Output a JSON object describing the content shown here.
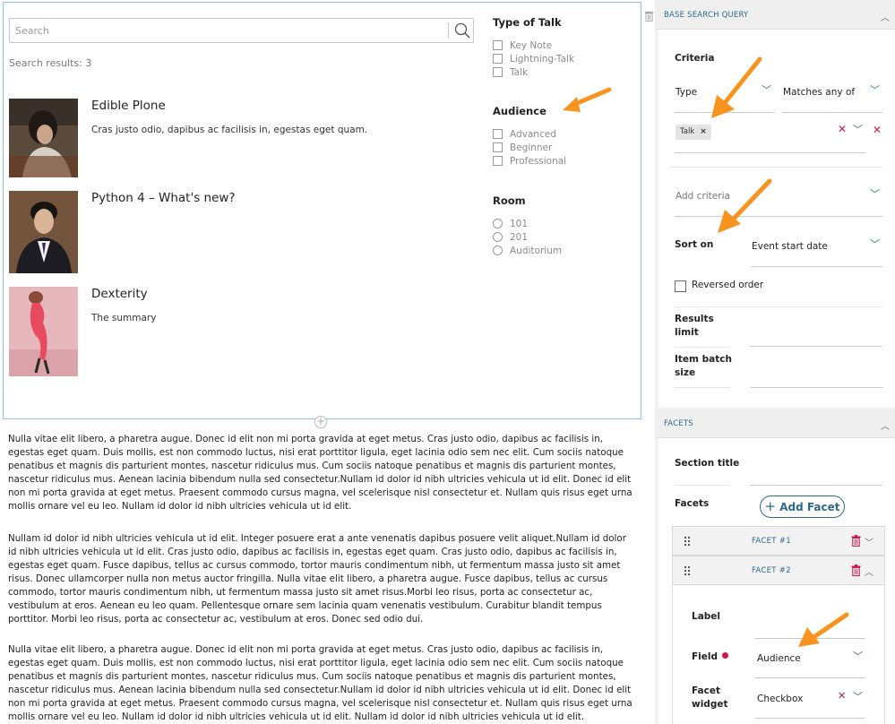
{
  "search": {
    "placeholder": "Search",
    "results_count": "Search results: 3"
  },
  "results": [
    {
      "title": "Edible Plone",
      "description": "Cras justo odio, dapibus ac facilisis in, egestas eget quam."
    },
    {
      "title": "Python 4 – What's new?",
      "description": ""
    },
    {
      "title": "Dexterity",
      "description": "The summary"
    }
  ],
  "facets_panel": [
    {
      "title": "Type of Talk",
      "options": [
        "Key Note",
        "Lightning-Talk",
        "Talk"
      ]
    },
    {
      "title": "Audience",
      "options": [
        "Advanced",
        "Beginner",
        "Professional"
      ]
    },
    {
      "title": "Room",
      "options": [
        "101",
        "201",
        "Auditorium"
      ]
    }
  ],
  "paragraphs": [
    "Nulla vitae elit libero, a pharetra augue. Donec id elit non mi porta gravida at eget metus. Cras justo odio, dapibus ac facilisis in, egestas eget quam. Duis mollis, est non commodo luctus, nisi erat porttitor ligula, eget lacinia odio sem nec elit. Cum sociis natoque penatibus et magnis dis parturient montes, nascetur ridiculus mus. Cum sociis natoque penatibus et magnis dis parturient montes, nascetur ridiculus mus. Aenean lacinia bibendum nulla sed consectetur.Nullam id dolor id nibh ultricies vehicula ut id elit. Donec id elit non mi porta gravida at eget metus. Praesent commodo cursus magna, vel scelerisque nisl consectetur et. Nullam quis risus eget urna mollis ornare vel eu leo. Nullam id dolor id nibh ultricies vehicula ut id elit.",
    "Nullam id dolor id nibh ultricies vehicula ut id elit. Integer posuere erat a ante venenatis dapibus posuere velit aliquet.Nullam id dolor id nibh ultricies vehicula ut id elit. Cras justo odio, dapibus ac facilisis in, egestas eget quam. Cras justo odio, dapibus ac facilisis in, egestas eget quam. Fusce dapibus, tellus ac cursus commodo, tortor mauris condimentum nibh, ut fermentum massa justo sit amet risus. Donec ullamcorper nulla non metus auctor fringilla. Nulla vitae elit libero, a pharetra augue. Fusce dapibus, tellus ac cursus commodo, tortor mauris condimentum nibh, ut fermentum massa justo sit amet risus.Morbi leo risus, porta ac consectetur ac, vestibulum at eros. Aenean eu leo quam. Pellentesque ornare sem lacinia quam venenatis vestibulum. Curabitur blandit tempus porttitor. Morbi leo risus, porta ac consectetur ac, vestibulum at eros. Donec sed odio dui.",
    "Nulla vitae elit libero, a pharetra augue. Donec id elit non mi porta gravida at eget metus. Cras justo odio, dapibus ac facilisis in, egestas eget quam. Duis mollis, est non commodo luctus, nisi erat porttitor ligula, eget lacinia odio sem nec elit. Cum sociis natoque penatibus et magnis dis parturient montes, nascetur ridiculus mus. Cum sociis natoque penatibus et magnis dis parturient montes, nascetur ridiculus mus. Aenean lacinia bibendum nulla sed consectetur.Nullam id dolor id nibh ultricies vehicula ut id elit. Donec id elit non mi porta gravida at eget metus. Praesent commodo cursus magna, vel scelerisque nisl consectetur et. Nullam quis risus eget urna mollis ornare vel eu leo. Nullam id dolor id nibh ultricies vehicula ut id elit. Nullam id dolor id nibh ultricies vehicula ut id elit."
  ],
  "sidebar": {
    "base_header": "BASE SEARCH QUERY",
    "criteria_label": "Criteria",
    "type_label": "Type",
    "matches_label": "Matches any of",
    "chip_label": "Talk",
    "add_criteria": "Add criteria",
    "sort_on_label": "Sort on",
    "sort_on_value": "Event start date",
    "reversed_label": "Reversed order",
    "results_limit_label": "Results limit",
    "item_batch_label": "Item batch size",
    "facets_header": "FACETS",
    "section_title_label": "Section title",
    "facets_label": "Facets",
    "add_facet": "Add Facet",
    "facet1_name": "FACET #1",
    "facet2_name": "FACET #2",
    "label_label": "Label",
    "field_label": "Field",
    "field_value": "Audience",
    "widget_label": "Facet widget",
    "widget_value": "Checkbox"
  },
  "colors": {
    "accent": "#2e6a88",
    "required": "#d0154f",
    "annotation_arrow": "#f7931e"
  }
}
